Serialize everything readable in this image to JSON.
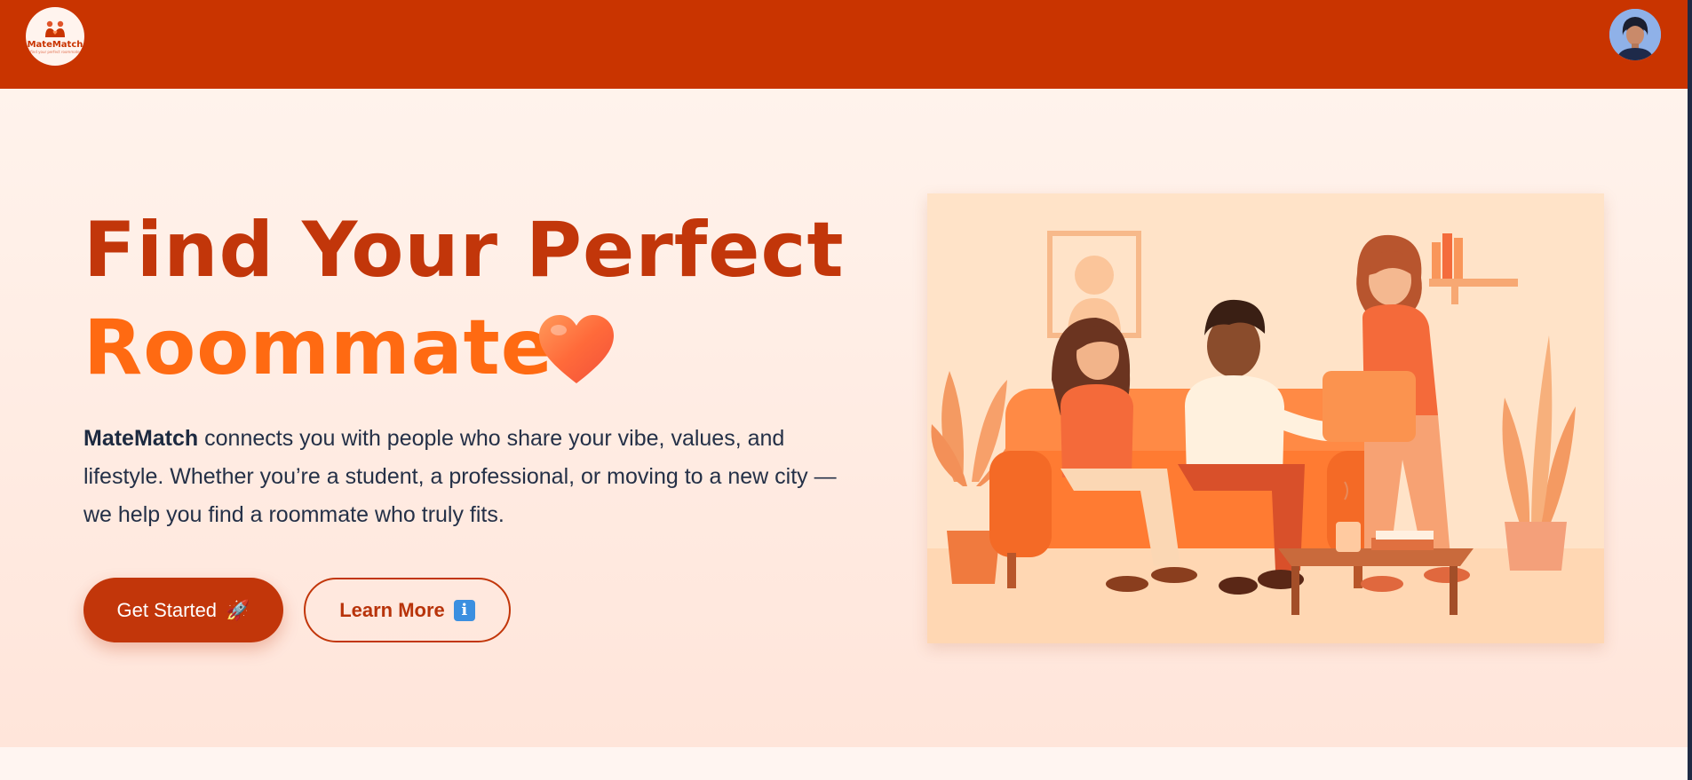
{
  "header": {
    "logo_name": "MateMatch",
    "logo_tagline": "find your perfect roommate",
    "avatar_label": "User profile"
  },
  "hero": {
    "title_line1": "Find Your Perfect",
    "title_line2": "Roommate",
    "description_brand": "MateMatch",
    "description_text": " connects you with people who share your vibe, values, and lifestyle. Whether you’re a student, a professional, or moving to a new city — we help you find a roommate who truly fits.",
    "primary_button": "Get Started",
    "primary_button_emoji": "🚀",
    "secondary_button": "Learn More"
  },
  "colors": {
    "header_bg": "#c93400",
    "title_dark": "#c2360a",
    "title_accent": "#ff6a12",
    "text": "#243047"
  }
}
